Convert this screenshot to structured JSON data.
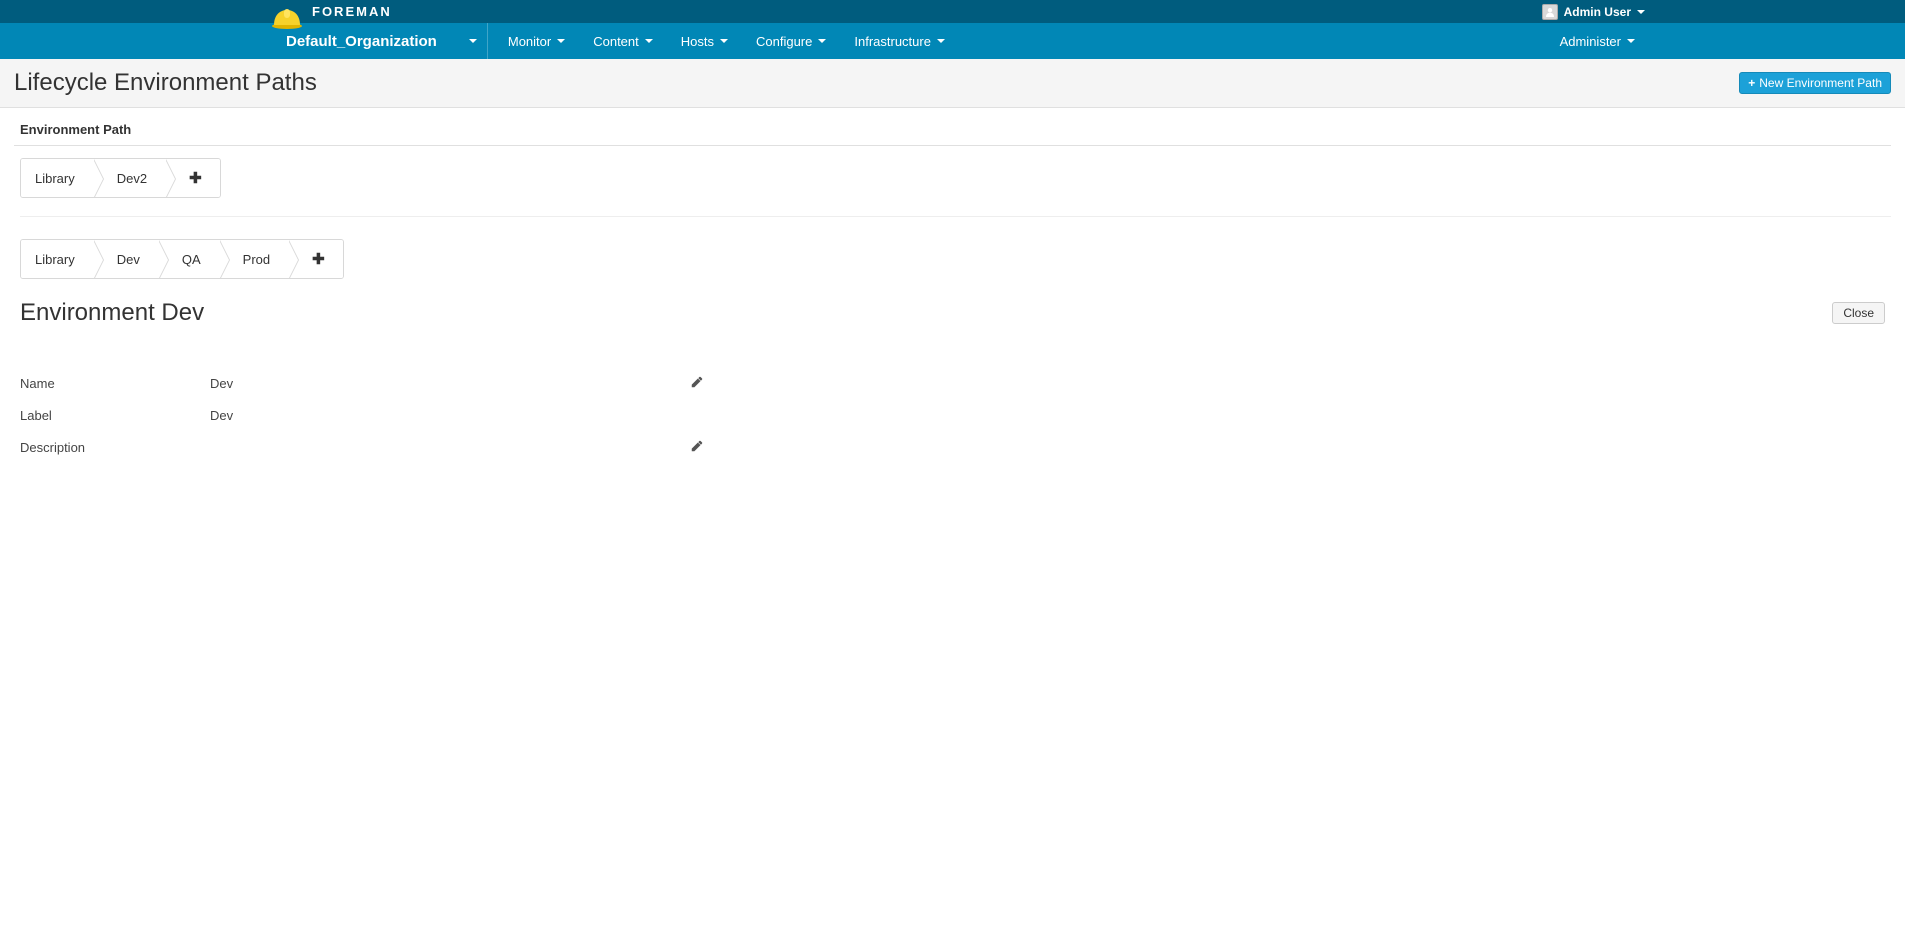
{
  "brand": {
    "name": "FOREMAN"
  },
  "user": {
    "display_name": "Admin User"
  },
  "org": {
    "current": "Default_Organization"
  },
  "nav": {
    "items": [
      "Monitor",
      "Content",
      "Hosts",
      "Configure",
      "Infrastructure"
    ],
    "right": [
      "Administer"
    ]
  },
  "page": {
    "title": "Lifecycle Environment Paths",
    "new_path_button": "New Environment Path"
  },
  "section": {
    "label": "Environment Path"
  },
  "paths": [
    {
      "steps": [
        "Library",
        "Dev2"
      ]
    },
    {
      "steps": [
        "Library",
        "Dev",
        "QA",
        "Prod"
      ]
    }
  ],
  "detail": {
    "title_prefix": "Environment",
    "title_name": "Dev",
    "close_label": "Close",
    "rows": {
      "name": {
        "label": "Name",
        "value": "Dev",
        "editable": true
      },
      "label": {
        "label": "Label",
        "value": "Dev",
        "editable": false
      },
      "description": {
        "label": "Description",
        "value": "",
        "editable": true
      }
    }
  }
}
